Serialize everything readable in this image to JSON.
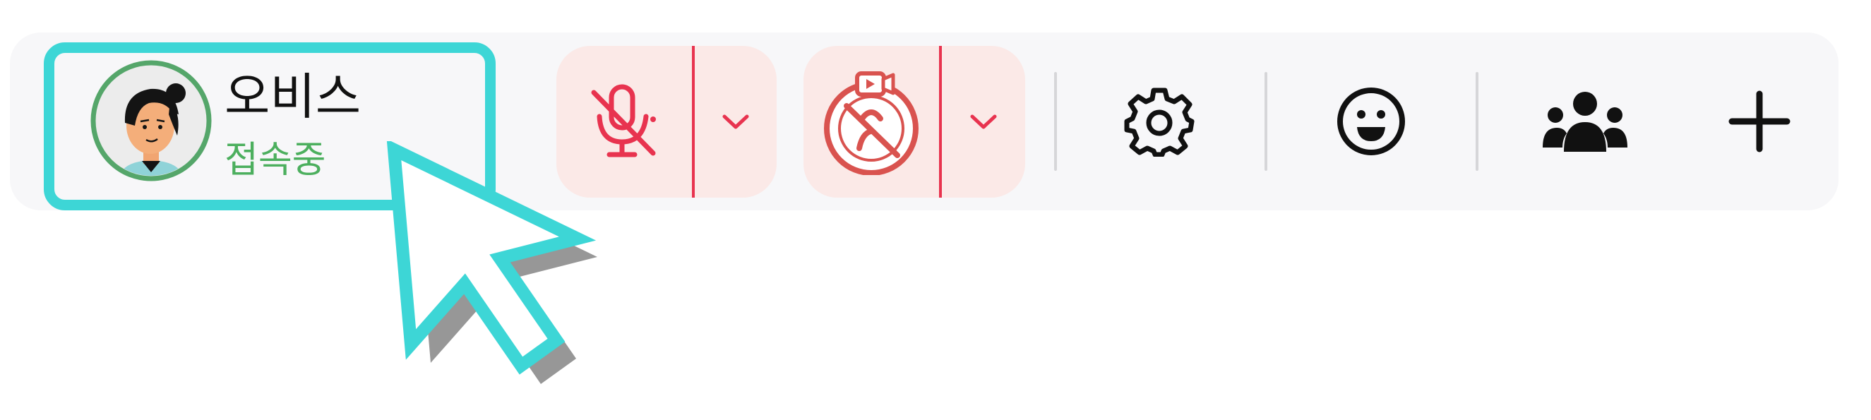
{
  "user": {
    "name": "오비스",
    "status": "접속중"
  },
  "controls": {
    "mic": {
      "state": "muted",
      "icon": "microphone-off-icon",
      "menu_icon": "chevron-down-icon"
    },
    "camera": {
      "state": "off",
      "icon": "camera-off-icon",
      "menu_icon": "chevron-down-icon"
    }
  },
  "tools": [
    {
      "icon": "gear-icon"
    },
    {
      "icon": "smiley-icon"
    },
    {
      "icon": "users-icon"
    },
    {
      "icon": "plus-icon"
    }
  ],
  "colors": {
    "highlight": "#3dd6d6",
    "status_online": "#4caf5e",
    "muted_accent": "#e8334f",
    "muted_background": "#fbe9e7",
    "toolbar_background": "#f7f7f9"
  }
}
